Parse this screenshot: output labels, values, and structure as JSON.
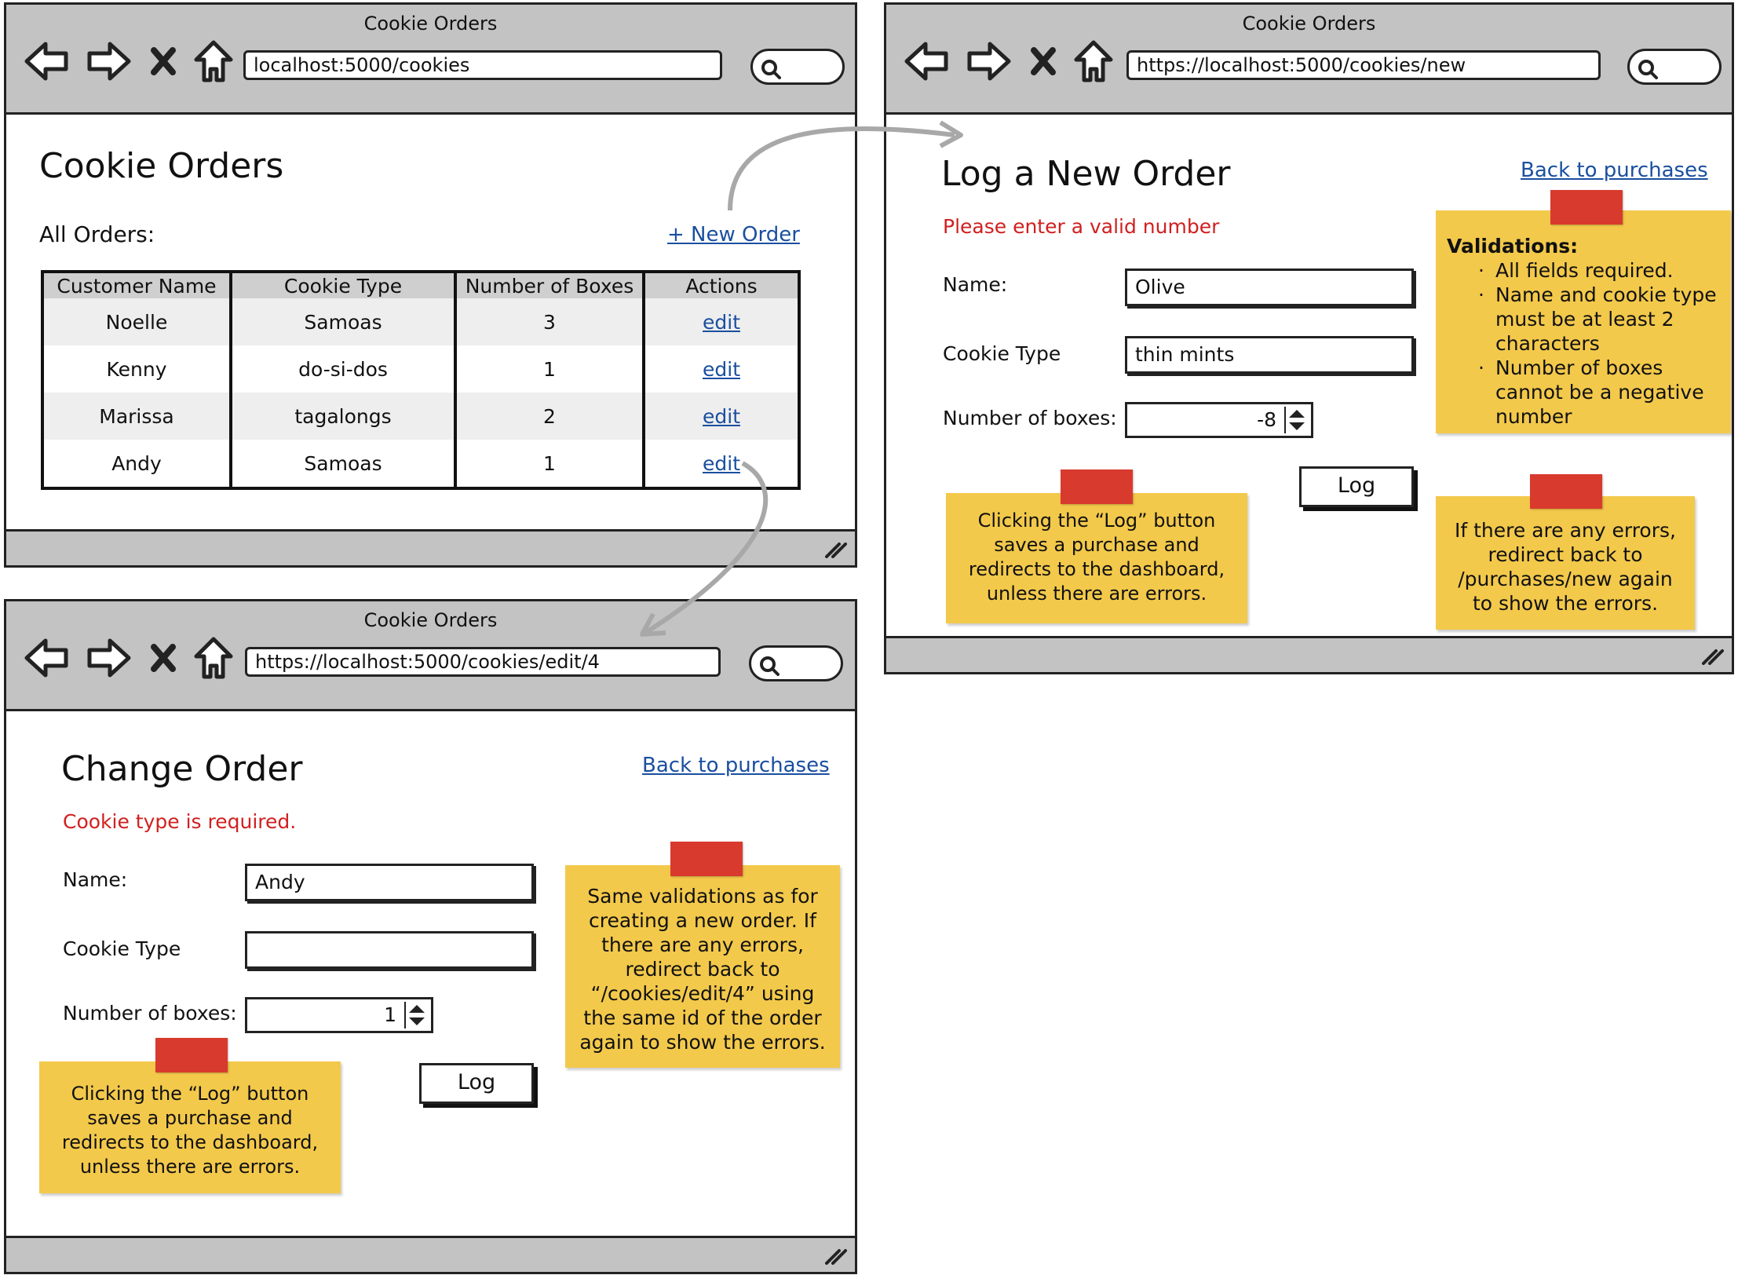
{
  "list_window": {
    "title": "Cookie Orders",
    "url": "localhost:5000/cookies",
    "heading": "Cookie Orders",
    "subheading": "All Orders:",
    "new_order_link": "+ New Order",
    "table": {
      "headers": [
        "Customer Name",
        "Cookie Type",
        "Number of Boxes",
        "Actions"
      ],
      "rows": [
        {
          "name": "Noelle",
          "type": "Samoas",
          "boxes": "3",
          "action": "edit"
        },
        {
          "name": "Kenny",
          "type": "do-si-dos",
          "boxes": "1",
          "action": "edit"
        },
        {
          "name": "Marissa",
          "type": "tagalongs",
          "boxes": "2",
          "action": "edit"
        },
        {
          "name": "Andy",
          "type": "Samoas",
          "boxes": "1",
          "action": "edit"
        }
      ]
    }
  },
  "new_window": {
    "title": "Cookie Orders",
    "url": "https://localhost:5000/cookies/new",
    "heading": "Log a New Order",
    "back_link": "Back to purchases",
    "error": "Please enter a valid number",
    "name_label": "Name:",
    "name_value": "Olive",
    "type_label": "Cookie Type",
    "type_value": "thin mints",
    "boxes_label": "Number of boxes:",
    "boxes_value": "-8",
    "log_button": "Log",
    "note_validations": {
      "title": "Validations:",
      "items": [
        "All fields required.",
        "Name and cookie type must be at least 2 characters",
        "Number of boxes cannot be a negative number"
      ]
    },
    "note_log": "Clicking the “Log” button saves a purchase and redirects to the dashboard, unless there are errors.",
    "note_errors": "If there are any errors, redirect back to /purchases/new again to show the errors."
  },
  "edit_window": {
    "title": "Cookie Orders",
    "url": "https://localhost:5000/cookies/edit/4",
    "heading": "Change Order",
    "back_link": "Back to purchases",
    "error": "Cookie type is required.",
    "name_label": "Name:",
    "name_value": "Andy",
    "type_label": "Cookie Type",
    "type_value": "",
    "boxes_label": "Number of boxes:",
    "boxes_value": "1",
    "log_button": "Log",
    "note_same": "Same validations as for creating a new order. If there are any errors, redirect back to “/cookies/edit/4” using the same id of the order again to show the errors.",
    "note_log": "Clicking the “Log” button saves a purchase and redirects to the dashboard, unless there are errors."
  },
  "colors": {
    "chrome": "#c3c3c3",
    "link": "#1a4fa0",
    "error": "#d11f1f",
    "sticky_note": "#f3c94b",
    "tape": "#d93a2e"
  }
}
